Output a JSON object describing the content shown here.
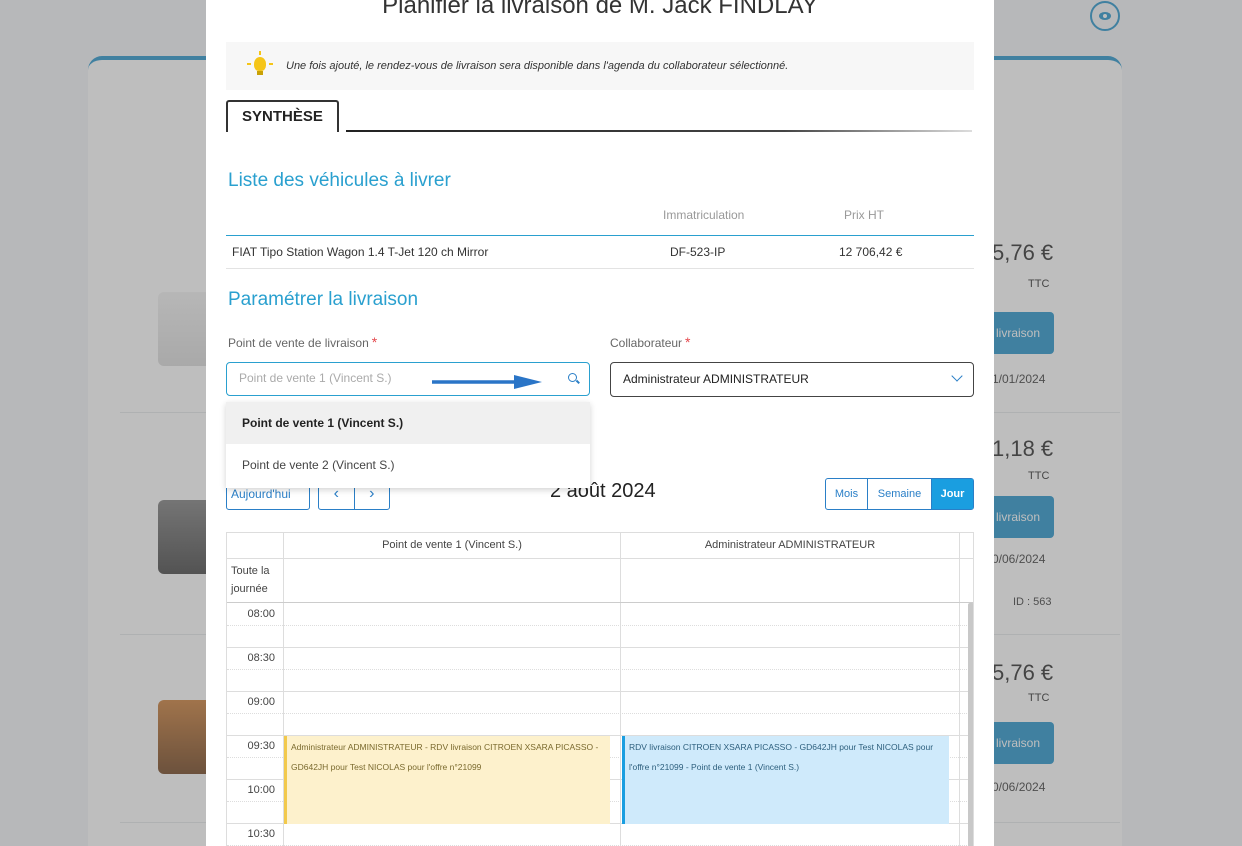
{
  "background": {
    "rows": [
      {
        "price": "5,76 €",
        "ttc": "TTC",
        "button": "livraison",
        "date": "1/01/2024",
        "id": ""
      },
      {
        "price": "1,18 €",
        "ttc": "TTC",
        "button": "livraison",
        "date": "0/06/2024",
        "id": "ID : 563"
      },
      {
        "price": "5,76 €",
        "ttc": "TTC",
        "button": "livraison",
        "date": "0/06/2024",
        "id": ""
      }
    ],
    "accent": "#1a8fc9"
  },
  "modal": {
    "title": "Planifier la livraison de M. Jack FINDLAY",
    "info": "Une fois ajouté, le rendez-vous de livraison sera disponible dans l'agenda du collaborateur sélectionné.",
    "tab": "SYNTHÈSE",
    "vehicles": {
      "title": "Liste des véhicules à livrer",
      "columns": [
        "",
        "Immatriculation",
        "Prix HT"
      ],
      "rows": [
        {
          "name": "FIAT Tipo Station Wagon 1.4 T-Jet 120 ch Mirror",
          "plate": "DF-523-IP",
          "price": "12 706,42 €"
        }
      ]
    },
    "settings": {
      "title": "Paramétrer la livraison",
      "point_label": "Point de vente de livraison",
      "required_mark": "*",
      "point_placeholder": "Point de vente 1 (Vincent S.)",
      "collab_label": "Collaborateur",
      "collab_value": "Administrateur ADMINISTRATEUR",
      "dropdown_options": [
        "Point de vente 1 (Vincent S.)",
        "Point de vente 2 (Vincent S.)"
      ]
    },
    "calendar": {
      "today": "Aujourd'hui",
      "prev": "‹",
      "next": "›",
      "date": "2 août 2024",
      "views": [
        "Mois",
        "Semaine",
        "Jour"
      ],
      "active_view": "Jour",
      "columns": [
        "Point de vente 1 (Vincent S.)",
        "Administrateur ADMINISTRATEUR"
      ],
      "allday_label": "Toute la journée",
      "times": [
        "08:00",
        "08:30",
        "09:00",
        "09:30",
        "10:00",
        "10:30"
      ],
      "events": [
        "Administrateur ADMINISTRATEUR - RDV livraison CITROEN XSARA PICASSO - GD642JH pour Test NICOLAS pour l'offre n°21099",
        "RDV livraison CITROEN XSARA PICASSO - GD642JH pour Test NICOLAS pour l'offre n°21099 - Point de vente 1 (Vincent S.)"
      ]
    },
    "colors": {
      "title_blue": "#2aa0cf",
      "button_blue": "#2a7fc7",
      "event_yellow": "#fdf1cc",
      "event_blue": "#cfeafb"
    }
  }
}
